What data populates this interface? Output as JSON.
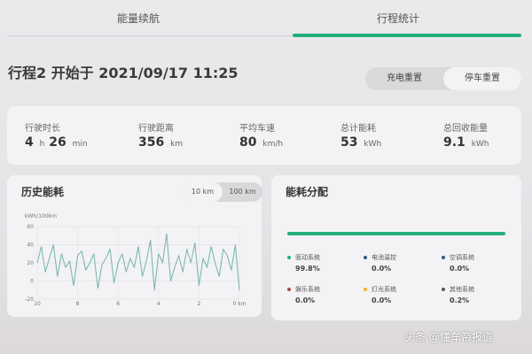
{
  "tabs": [
    {
      "label": "能量续航"
    },
    {
      "label": "行程统计",
      "active": true
    }
  ],
  "trip": {
    "title": "行程2 开始于 2021/09/17 11:25"
  },
  "reset": {
    "charge_reset": "充电重置",
    "park_reset": "停车重置"
  },
  "stats": [
    {
      "label": "行驶时长",
      "value_h": "4",
      "unit_h": "h",
      "value_m": "26",
      "unit_m": "min"
    },
    {
      "label": "行驶距离",
      "value": "356",
      "unit": "km"
    },
    {
      "label": "平均车速",
      "value": "80",
      "unit": "km/h"
    },
    {
      "label": "总计能耗",
      "value": "53",
      "unit": "kWh"
    },
    {
      "label": "总回收能量",
      "value": "9.1",
      "unit": "kWh"
    }
  ],
  "history": {
    "title": "历史能耗",
    "range_options": [
      "10 km",
      "100 km"
    ],
    "selected_range": "10 km",
    "y_unit": "kWh/100km"
  },
  "chart_data": {
    "type": "line",
    "title": "历史能耗",
    "ylabel": "kWh/100km",
    "xlabel": "",
    "xlim": [
      10,
      0
    ],
    "ylim": [
      -20,
      60
    ],
    "x_ticks": [
      "10",
      "8",
      "6",
      "4",
      "2",
      "0 km"
    ],
    "y_ticks": [
      "60",
      "40",
      "20",
      "0",
      "-20"
    ],
    "grid": true,
    "series": [
      {
        "color": "#7fb8b0",
        "x": [
          10,
          9.8,
          9.6,
          9.4,
          9.2,
          9,
          8.8,
          8.6,
          8.4,
          8.2,
          8,
          7.8,
          7.6,
          7.4,
          7.2,
          7,
          6.8,
          6.6,
          6.4,
          6.2,
          6,
          5.8,
          5.6,
          5.4,
          5.2,
          5,
          4.8,
          4.6,
          4.4,
          4.2,
          4,
          3.8,
          3.6,
          3.4,
          3.2,
          3,
          2.8,
          2.6,
          2.4,
          2.2,
          2,
          1.8,
          1.6,
          1.4,
          1.2,
          1,
          0.8,
          0.6,
          0.4,
          0.2,
          0
        ],
        "y": [
          20,
          38,
          10,
          25,
          40,
          5,
          30,
          15,
          22,
          -5,
          28,
          33,
          12,
          20,
          30,
          -8,
          18,
          25,
          35,
          -2,
          20,
          30,
          10,
          25,
          15,
          38,
          5,
          22,
          45,
          -10,
          30,
          20,
          52,
          0,
          15,
          28,
          10,
          35,
          20,
          42,
          -5,
          25,
          15,
          38,
          20,
          5,
          35,
          28,
          12,
          40,
          -10
        ]
      }
    ]
  },
  "distribution": {
    "title": "能耗分配",
    "bar_color": "#22b07a",
    "items": [
      {
        "name": "驱动系统",
        "pct": "99.8%",
        "color": "#22b07a"
      },
      {
        "name": "电池温控",
        "pct": "0.0%",
        "color": "#2f5a8c"
      },
      {
        "name": "空调系统",
        "pct": "0.0%",
        "color": "#2f5a8c"
      },
      {
        "name": "娱乐系统",
        "pct": "0.0%",
        "color": "#a04a4a"
      },
      {
        "name": "灯光系统",
        "pct": "0.0%",
        "color": "#f0b020"
      },
      {
        "name": "其他系统",
        "pct": "0.2%",
        "color": "#555555"
      }
    ]
  },
  "watermark": "头条 @懂车帝报道"
}
